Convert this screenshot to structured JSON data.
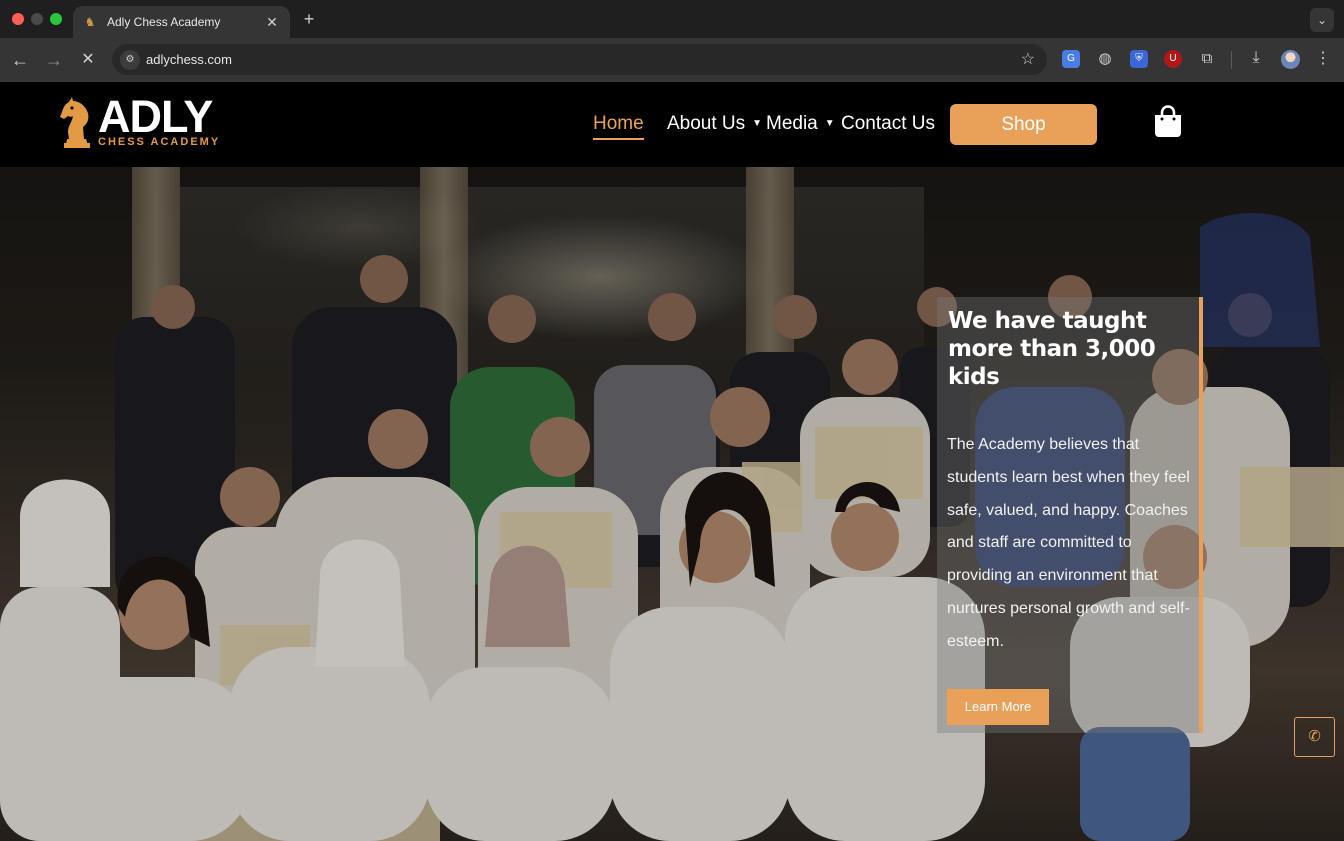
{
  "browser": {
    "tab_title": "Adly Chess Academy",
    "tab_close": "✕",
    "new_tab": "+",
    "url": "adlychess.com"
  },
  "site": {
    "logo_word": "ADLY",
    "logo_sub": "CHESS ACADEMY",
    "nav": {
      "home": "Home",
      "about": "About Us",
      "media": "Media",
      "contact": "Contact Us"
    },
    "shop_label": "Shop"
  },
  "hero": {
    "title": "We have taught more than 3,000 kids",
    "text": "The Academy believes that students learn best when they feel safe, valued, and happy. Coaches and staff are committed to providing an environment that nurtures personal growth and self-esteem.",
    "button_label": "Learn More"
  },
  "colors": {
    "accent": "#e9a15a",
    "header_bg": "#000000",
    "chrome_bg": "#353535"
  },
  "icons": {
    "back": "arrow-left-icon",
    "forward": "arrow-right-icon",
    "stop": "close-icon",
    "cart": "shopping-bag-icon",
    "phone": "phone-icon"
  }
}
